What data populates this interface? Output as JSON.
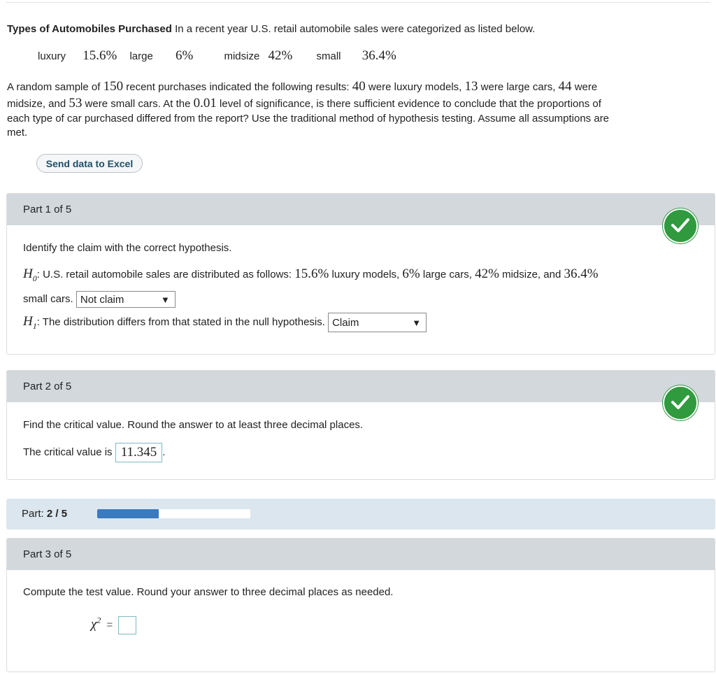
{
  "problem": {
    "title": "Types of Automobiles Purchased",
    "intro": "In a recent year U.S. retail automobile sales were categorized as listed below.",
    "categories": [
      {
        "label": "luxury",
        "value": "15.6%"
      },
      {
        "label": "large",
        "value": "6%"
      },
      {
        "label": "midsize",
        "value": "42%"
      },
      {
        "label": "small",
        "value": "36.4%"
      }
    ],
    "p1": "A random sample of ",
    "n": "150",
    "p2": " recent purchases indicated the following results: ",
    "luxury_count": "40",
    "p3": " were luxury models, ",
    "large_count": "13",
    "p4": " were large cars, ",
    "midsize_count": "44",
    "p5": " were",
    "p6": "midsize, and ",
    "small_count": "53",
    "p7": " were small cars. At the ",
    "alpha": "0.01",
    "p8": " level of significance, is there sufficient evidence to conclude that the proportions of",
    "p9": "each type of car purchased differed from the report? Use the traditional method of hypothesis testing. Assume all assumptions are",
    "p10": "met."
  },
  "excel_button": "Send data to Excel",
  "part1": {
    "header": "Part 1 of 5",
    "prompt": "Identify the claim with the correct hypothesis.",
    "h0_text": ": U.S. retail automobile sales are distributed as follows: ",
    "h0_v1": "15.6%",
    "h0_t1": " luxury models, ",
    "h0_v2": "6%",
    "h0_t2": " large cars, ",
    "h0_v3": "42%",
    "h0_t3": " midsize, and ",
    "h0_v4": "36.4%",
    "h0_line2": "small cars.",
    "h0_select": "Not claim",
    "h1_text": ": The distribution differs from that stated in the null hypothesis.",
    "h1_select": "Claim"
  },
  "part2": {
    "header": "Part 2 of 5",
    "prompt": "Find the critical value. Round the answer to at least three decimal places.",
    "answer_label": "The critical value is",
    "answer": "11.345",
    "period": "."
  },
  "progress": {
    "label": "Part:",
    "value": "2 / 5",
    "fraction": 0.4
  },
  "part3": {
    "header": "Part 3 of 5",
    "prompt": "Compute the test value. Round your answer to three decimal places as needed.",
    "chi_eq": "="
  },
  "colors": {
    "check": "#2f9a3e",
    "progress_fill": "#3a7abf",
    "header_bg": "#d2d8dc"
  },
  "icons": [
    "checkmark-icon",
    "dropdown-arrow-icon"
  ]
}
